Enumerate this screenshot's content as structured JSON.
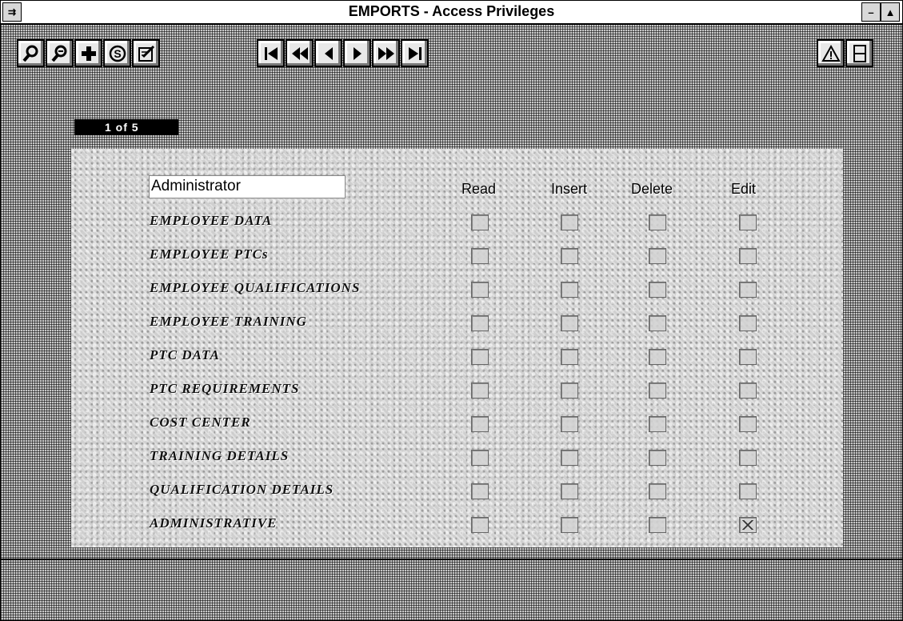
{
  "window": {
    "title": "EMPORTS - Access Privileges",
    "sysmenu_icon": "system-menu-icon",
    "minimize_icon": "minimize-icon",
    "maximize_icon": "maximize-icon"
  },
  "toolbar": {
    "buttons": [
      {
        "name": "find-icon"
      },
      {
        "name": "zoom-icon"
      },
      {
        "name": "add-record-icon"
      },
      {
        "name": "save-icon"
      },
      {
        "name": "edit-icon"
      },
      {
        "name": "first-record-icon"
      },
      {
        "name": "rewind-icon"
      },
      {
        "name": "previous-record-icon"
      },
      {
        "name": "next-record-icon"
      },
      {
        "name": "fast-forward-icon"
      },
      {
        "name": "last-record-icon"
      },
      {
        "name": "warning-icon"
      },
      {
        "name": "layout-icon"
      }
    ]
  },
  "record_indicator": "1 of 5",
  "form": {
    "role_value": "Administrator",
    "columns": [
      "Read",
      "Insert",
      "Delete",
      "Edit"
    ],
    "rows": [
      {
        "label": "EMPLOYEE DATA",
        "checked": [
          false,
          false,
          false,
          false
        ]
      },
      {
        "label": "EMPLOYEE PTCs",
        "checked": [
          false,
          false,
          false,
          false
        ]
      },
      {
        "label": "EMPLOYEE QUALIFICATIONS",
        "checked": [
          false,
          false,
          false,
          false
        ]
      },
      {
        "label": "EMPLOYEE TRAINING",
        "checked": [
          false,
          false,
          false,
          false
        ]
      },
      {
        "label": "PTC DATA",
        "checked": [
          false,
          false,
          false,
          false
        ]
      },
      {
        "label": "PTC REQUIREMENTS",
        "checked": [
          false,
          false,
          false,
          false
        ]
      },
      {
        "label": "COST CENTER",
        "checked": [
          false,
          false,
          false,
          false
        ]
      },
      {
        "label": "TRAINING DETAILS",
        "checked": [
          false,
          false,
          false,
          false
        ]
      },
      {
        "label": "QUALIFICATION DETAILS",
        "checked": [
          false,
          false,
          false,
          false
        ]
      },
      {
        "label": "ADMINISTRATIVE",
        "checked": [
          false,
          false,
          false,
          true
        ]
      }
    ]
  }
}
